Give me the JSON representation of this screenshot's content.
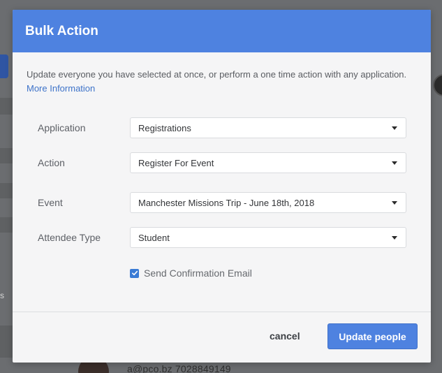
{
  "background": {
    "side_text": "s",
    "contact": "a@pco.bz  7028849149"
  },
  "modal": {
    "title": "Bulk Action",
    "intro_text": "Update everyone you have selected at once, or perform a one time action with any application.",
    "more_info_link": "More Information",
    "fields": [
      {
        "label": "Application",
        "value": "Registrations"
      },
      {
        "label": "Action",
        "value": "Register For Event"
      },
      {
        "label": "Event",
        "value": "Manchester Missions Trip - June 18th, 2018"
      },
      {
        "label": "Attendee Type",
        "value": "Student"
      }
    ],
    "send_confirmation": {
      "label": "Send Confirmation Email",
      "checked": true
    },
    "cancel_label": "cancel",
    "submit_label": "Update people"
  },
  "colors": {
    "header": "#4e82e0",
    "primary_button": "#4e82e0",
    "link": "#3e73c9",
    "checkbox": "#3a7bd5"
  }
}
